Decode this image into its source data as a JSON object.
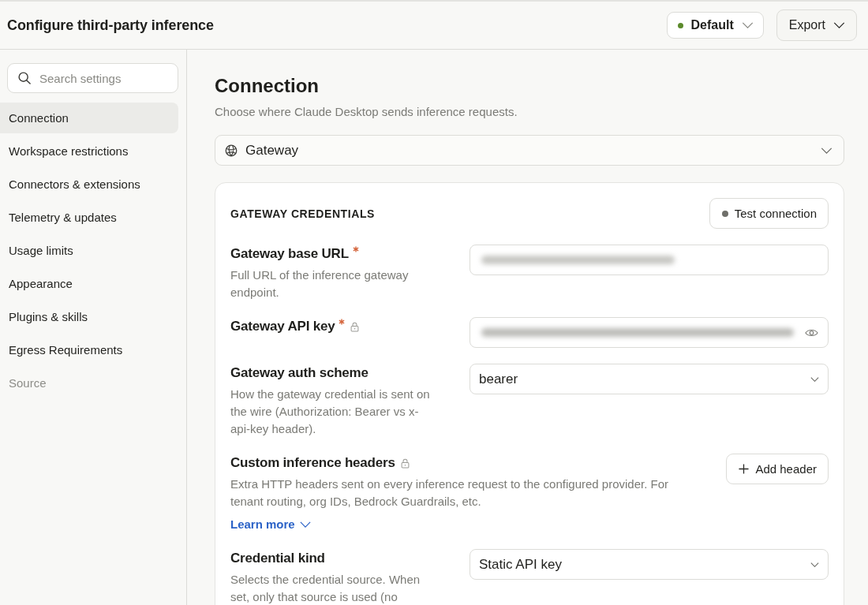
{
  "window": {
    "title": "Configure third-party inference"
  },
  "header_actions": {
    "profile": {
      "label": "Default"
    },
    "export": {
      "label": "Export"
    }
  },
  "sidebar": {
    "search": {
      "placeholder": "Search settings"
    },
    "items": [
      {
        "label": "Connection",
        "selected": true,
        "disabled": false
      },
      {
        "label": "Workspace restrictions",
        "selected": false,
        "disabled": false
      },
      {
        "label": "Connectors & extensions",
        "selected": false,
        "disabled": false
      },
      {
        "label": "Telemetry & updates",
        "selected": false,
        "disabled": false
      },
      {
        "label": "Usage limits",
        "selected": false,
        "disabled": false
      },
      {
        "label": "Appearance",
        "selected": false,
        "disabled": false
      },
      {
        "label": "Plugins & skills",
        "selected": false,
        "disabled": false
      },
      {
        "label": "Egress Requirements",
        "selected": false,
        "disabled": false
      },
      {
        "label": "Source",
        "selected": false,
        "disabled": true
      }
    ]
  },
  "main": {
    "title": "Connection",
    "subtitle": "Choose where Claude Desktop sends inference requests.",
    "provider_select": {
      "value": "Gateway"
    },
    "card": {
      "title": "GATEWAY CREDENTIALS",
      "test_button": {
        "label": "Test connection"
      },
      "fields": [
        {
          "kind": "text",
          "label": "Gateway base URL",
          "required": true,
          "locked": false,
          "description": "Full URL of the inference gateway endpoint.",
          "value_redacted": true
        },
        {
          "kind": "secret",
          "label": "Gateway API key",
          "required": true,
          "locked": true,
          "value_redacted": true
        },
        {
          "kind": "select",
          "label": "Gateway auth scheme",
          "required": false,
          "locked": false,
          "description": "How the gateway credential is sent on the wire (Authorization: Bearer vs x-api-key header).",
          "value": "bearer"
        },
        {
          "kind": "headers",
          "label": "Custom inference headers",
          "required": false,
          "locked": true,
          "description": "Extra HTTP headers sent on every inference request to the configured provider. For tenant routing, org IDs, Bedrock Guardrails, etc.",
          "button": "Add header",
          "link": "Learn more"
        },
        {
          "kind": "select",
          "label": "Credential kind",
          "required": false,
          "locked": false,
          "description": "Selects the credential source. When set, only that source is used (no",
          "value": "Static API key"
        }
      ]
    }
  }
}
